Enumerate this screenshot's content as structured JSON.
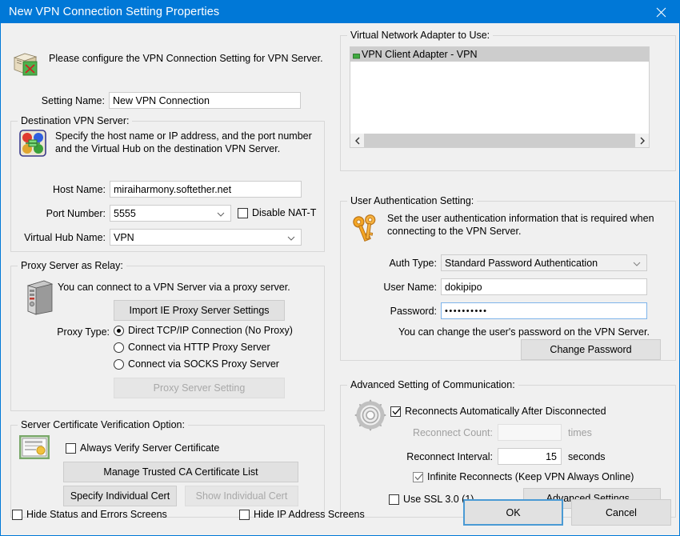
{
  "window": {
    "title": "New VPN Connection Setting Properties",
    "close_icon": "close-icon"
  },
  "header": {
    "icon": "vpn-connection-package-icon",
    "description": "Please configure the VPN Connection Setting for VPN Server."
  },
  "setting_name": {
    "label": "Setting Name:",
    "value": "New VPN Connection"
  },
  "destination": {
    "group_title": "Destination VPN Server:",
    "icon": "virtual-hub-icon",
    "description_line1": "Specify the host name or IP address, and the port number",
    "description_line2": "and the Virtual Hub on the destination VPN Server.",
    "host_name_label": "Host Name:",
    "host_name_value": "miraiharmony.softether.net",
    "port_label": "Port Number:",
    "port_value": "5555",
    "disable_natt_label": "Disable NAT-T",
    "disable_natt_checked": false,
    "hub_label": "Virtual Hub Name:",
    "hub_value": "VPN"
  },
  "proxy": {
    "group_title": "Proxy Server as Relay:",
    "icon": "computer-tower-icon",
    "description": "You can connect to a VPN Server via a proxy server.",
    "import_button": "Import IE Proxy Server Settings",
    "proxy_type_label": "Proxy Type:",
    "options": [
      {
        "label": "Direct TCP/IP Connection (No Proxy)",
        "selected": true
      },
      {
        "label": "Connect via HTTP Proxy Server",
        "selected": false
      },
      {
        "label": "Connect via SOCKS Proxy Server",
        "selected": false
      }
    ],
    "proxy_setting_button": "Proxy Server Setting",
    "proxy_setting_disabled": true
  },
  "certificate": {
    "group_title": "Server Certificate Verification Option:",
    "icon": "certificate-icon",
    "always_verify_label": "Always Verify Server Certificate",
    "always_verify_checked": false,
    "manage_ca_button": "Manage Trusted CA Certificate List",
    "specify_cert_button": "Specify Individual Cert",
    "show_cert_button": "Show Individual Cert",
    "show_cert_disabled": true
  },
  "adapter": {
    "group_title": "Virtual Network Adapter to Use:",
    "items": [
      {
        "label": "VPN Client Adapter - VPN",
        "icon": "network-adapter-icon",
        "selected": true
      }
    ],
    "scroll_left_icon": "chevron-left-icon",
    "scroll_right_icon": "chevron-right-icon"
  },
  "auth": {
    "group_title": "User Authentication Setting:",
    "icon": "keys-icon",
    "description_line1": "Set the user authentication information that is required when",
    "description_line2": "connecting to the VPN Server.",
    "auth_type_label": "Auth Type:",
    "auth_type_value": "Standard Password Authentication",
    "user_name_label": "User Name:",
    "user_name_value": "dokipipo",
    "password_label": "Password:",
    "password_value": "••••••••••",
    "hint": "You can change the user's password on the VPN Server.",
    "change_password_button": "Change Password"
  },
  "advanced": {
    "group_title": "Advanced Setting of Communication:",
    "icon": "gear-icon",
    "reconnect_auto_label": "Reconnects Automatically After Disconnected",
    "reconnect_auto_checked": true,
    "reconnect_count_label": "Reconnect Count:",
    "reconnect_count_value": "",
    "reconnect_count_unit": "times",
    "reconnect_count_disabled": true,
    "reconnect_interval_label": "Reconnect Interval:",
    "reconnect_interval_value": "15",
    "reconnect_interval_unit": "seconds",
    "infinite_label": "Infinite Reconnects (Keep VPN Always Online)",
    "infinite_checked": true,
    "use_ssl3_label": "Use SSL 3.0 (1)",
    "use_ssl3_checked": false,
    "advanced_settings_button": "Advanced Settings..."
  },
  "footer": {
    "hide_status_label": "Hide Status and Errors Screens",
    "hide_status_checked": false,
    "hide_ip_label": "Hide IP Address Screens",
    "hide_ip_checked": false,
    "ok_button": "OK",
    "cancel_button": "Cancel"
  },
  "colors": {
    "titlebar": "#0078d7",
    "dialog": "#f0f0f0",
    "focus_border": "#7eb4ea",
    "selection": "#cdcdcd"
  }
}
